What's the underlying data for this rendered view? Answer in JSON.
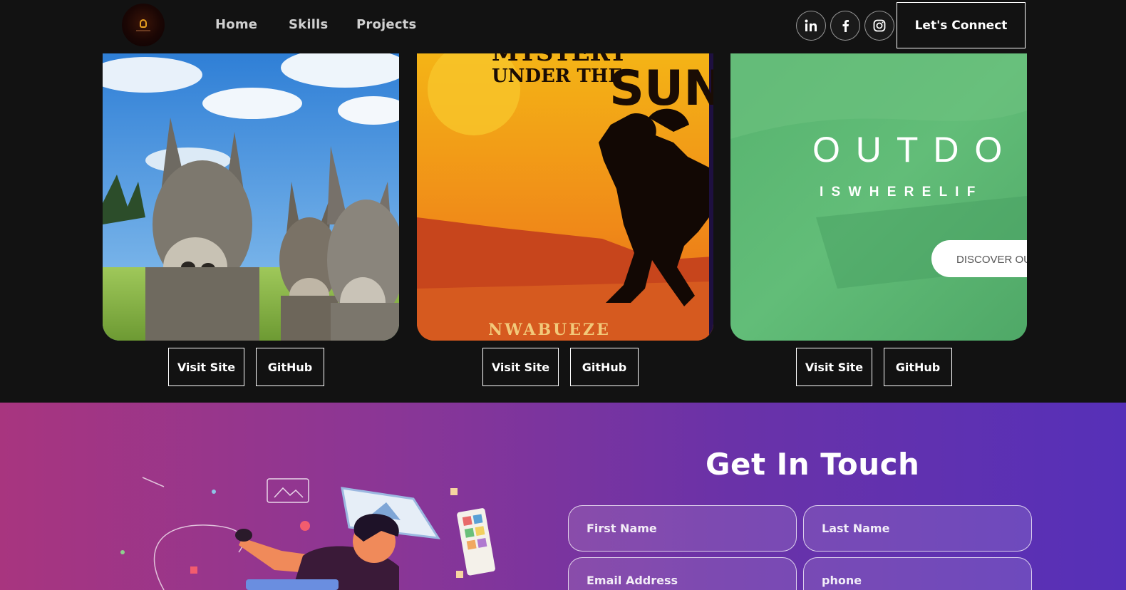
{
  "nav": {
    "links": [
      "Home",
      "Skills",
      "Projects"
    ],
    "social_icons": [
      "linkedin-icon",
      "facebook-icon",
      "instagram-icon"
    ],
    "cta_label": "Let's Connect"
  },
  "projects": [
    {
      "image": "donkeys-photo",
      "visit_label": "Visit Site",
      "github_label": "GitHub"
    },
    {
      "image": "book-cover",
      "cover_title_top": "MYSTERY",
      "cover_title_mid": "UNDER THE",
      "cover_title_big": "SUN",
      "cover_author": "NWABUEZE",
      "visit_label": "Visit Site",
      "github_label": "GitHub"
    },
    {
      "image": "outdoor-landing",
      "headline": "O U T D O",
      "tagline": "I S   W H E R E   L I F",
      "cta": "DISCOVER OUR",
      "visit_label": "Visit Site",
      "github_label": "GitHub"
    }
  ],
  "contact": {
    "title": "Get In Touch",
    "fields": {
      "first_name": "First Name",
      "last_name": "Last Name",
      "email": "Email Address",
      "phone": "phone"
    }
  },
  "colors": {
    "background": "#121212",
    "contact_gradient_start": "#a8357f",
    "contact_gradient_end": "#5630b8"
  }
}
